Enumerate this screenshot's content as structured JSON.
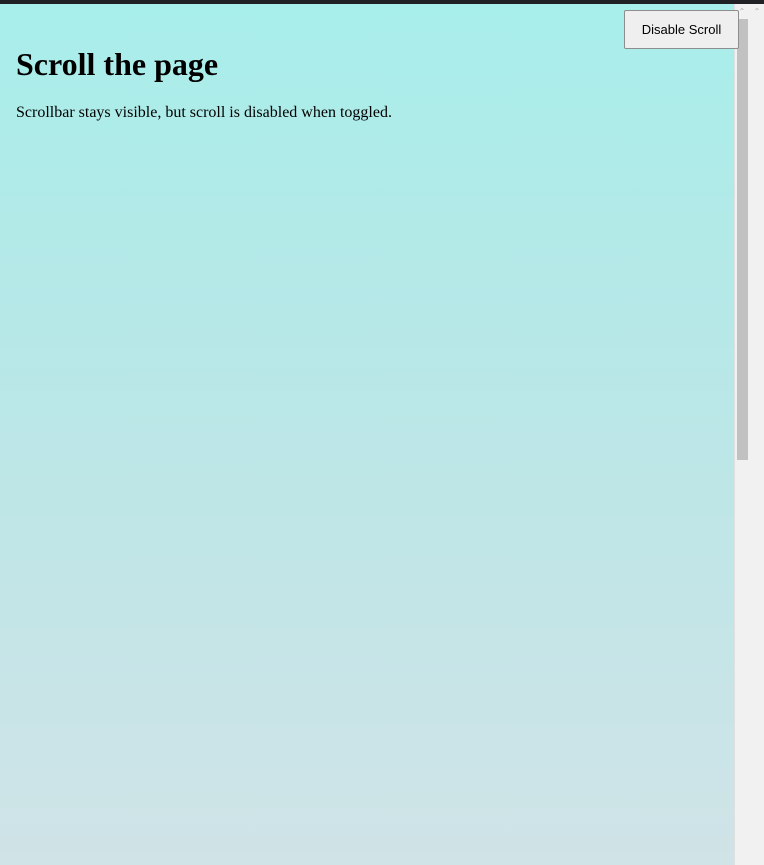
{
  "page": {
    "title": "Scroll the page",
    "description": "Scrollbar stays visible, but scroll is disabled when toggled."
  },
  "controls": {
    "toggle_label": "Disable Scroll"
  },
  "scrollbar": {
    "up_icon": "chevron-up-icon",
    "thumb_fraction": 0.51
  },
  "colors": {
    "background_top": "#a8eeea",
    "background_bottom": "#d0e3e7",
    "button_background": "#efefef",
    "scrollbar_thumb": "#c1c1c1"
  }
}
